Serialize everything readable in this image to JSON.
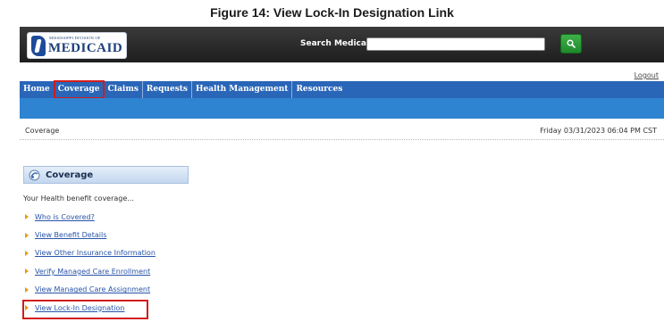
{
  "figure": {
    "caption": "Figure 14: View Lock-In Designation Link"
  },
  "header": {
    "logo_top": "MISSISSIPPI DIVISION OF",
    "logo_main": "MEDICAID",
    "search_label": "Search Medicaid:",
    "search_value": "",
    "logout": "Logout"
  },
  "nav": {
    "items": [
      {
        "label": "Home"
      },
      {
        "label": "Coverage"
      },
      {
        "label": "Claims"
      },
      {
        "label": "Requests"
      },
      {
        "label": "Health Management"
      },
      {
        "label": "Resources"
      }
    ],
    "highlighted": "Coverage"
  },
  "breadcrumb": {
    "text": "Coverage",
    "datetime": "Friday 03/31/2023 06:04 PM CST"
  },
  "coverage": {
    "title": "Coverage",
    "description": "Your Health benefit coverage...",
    "links": [
      {
        "label": "Who is Covered?"
      },
      {
        "label": "View Benefit Details"
      },
      {
        "label": "View Other Insurance Information"
      },
      {
        "label": "Verify Managed Care Enrollment"
      },
      {
        "label": "View Managed Care Assignment"
      },
      {
        "label": "View Lock-In Designation"
      }
    ],
    "highlighted": "View Lock-In Designation"
  },
  "colors": {
    "header_dark": "#2b2b2b",
    "nav_blue": "#2a66b8",
    "subbar_blue": "#2f84d2",
    "highlight_red": "#d21c1c",
    "search_green": "#2a9d36",
    "link_blue": "#2854a8",
    "bullet_orange": "#e89b10"
  },
  "icons": {
    "search_button": "search-icon",
    "coverage_panel": "coverage-icon"
  }
}
